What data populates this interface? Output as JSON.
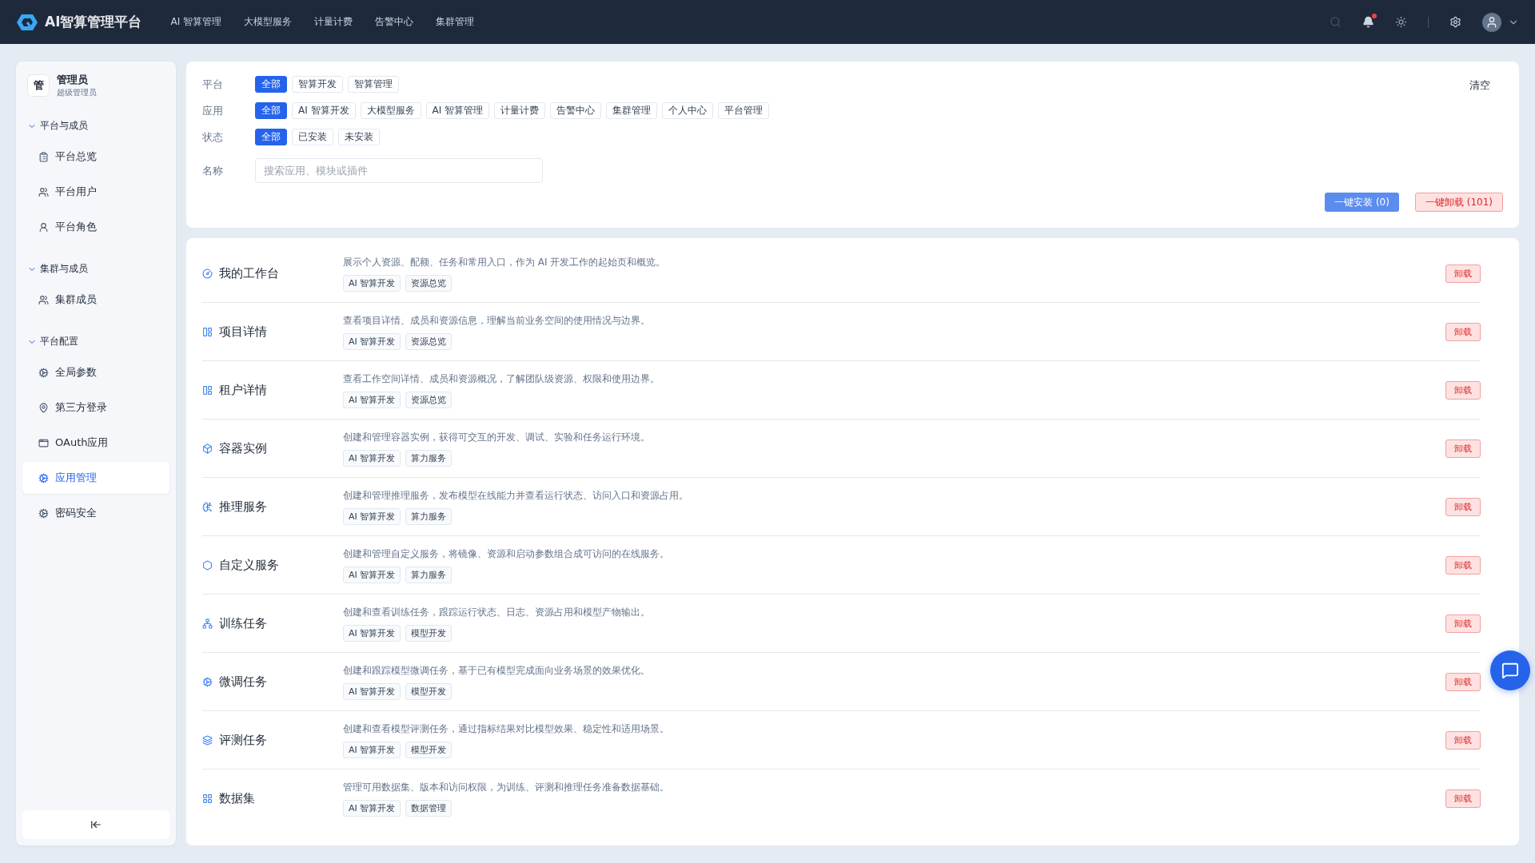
{
  "header": {
    "logo_text": "AI智算管理平台",
    "nav": [
      {
        "label": "AI 智算管理"
      },
      {
        "label": "大模型服务"
      },
      {
        "label": "计量计费"
      },
      {
        "label": "告警中心"
      },
      {
        "label": "集群管理"
      }
    ],
    "notification_dot": true
  },
  "sidebar": {
    "user": {
      "avatar": "管",
      "name": "管理员",
      "role": "超级管理员"
    },
    "groups": [
      {
        "title": "平台与成员",
        "expanded": true,
        "items": [
          {
            "label": "平台总览",
            "selected": false
          },
          {
            "label": "平台用户",
            "selected": false
          },
          {
            "label": "平台角色",
            "selected": false
          }
        ]
      },
      {
        "title": "集群与成员",
        "expanded": true,
        "items": [
          {
            "label": "集群成员",
            "selected": false
          }
        ]
      },
      {
        "title": "平台配置",
        "expanded": true,
        "items": [
          {
            "label": "全局参数",
            "selected": false
          },
          {
            "label": "第三方登录",
            "selected": false
          },
          {
            "label": "OAuth应用",
            "selected": false
          },
          {
            "label": "应用管理",
            "selected": true
          },
          {
            "label": "密码安全",
            "selected": false
          }
        ]
      }
    ]
  },
  "filters": {
    "clear": "清空",
    "rows": [
      {
        "label": "平台",
        "options": [
          {
            "label": "全部",
            "selected": true
          },
          {
            "label": "智算开发",
            "selected": false
          },
          {
            "label": "智算管理",
            "selected": false
          }
        ]
      },
      {
        "label": "应用",
        "options": [
          {
            "label": "全部",
            "selected": true
          },
          {
            "label": "AI 智算开发",
            "selected": false
          },
          {
            "label": "大模型服务",
            "selected": false
          },
          {
            "label": "AI 智算管理",
            "selected": false
          },
          {
            "label": "计量计费",
            "selected": false
          },
          {
            "label": "告警中心",
            "selected": false
          },
          {
            "label": "集群管理",
            "selected": false
          },
          {
            "label": "个人中心",
            "selected": false
          },
          {
            "label": "平台管理",
            "selected": false
          }
        ]
      },
      {
        "label": "状态",
        "options": [
          {
            "label": "全部",
            "selected": true
          },
          {
            "label": "已安装",
            "selected": false
          },
          {
            "label": "未安装",
            "selected": false
          }
        ]
      }
    ],
    "name_label": "名称",
    "search": {
      "placeholder": "搜索应用、模块或插件"
    },
    "install_all": "一键安装 (0)",
    "uninstall_all": "一键卸载 (101)"
  },
  "apps": [
    {
      "name": "我的工作台",
      "description": "展示个人资源、配额、任务和常用入口，作为 AI 开发工作的起始页和概览。",
      "tags": [
        "AI 智算开发",
        "资源总览"
      ],
      "action": "卸载"
    },
    {
      "name": "项目详情",
      "description": "查看项目详情、成员和资源信息，理解当前业务空间的使用情况与边界。",
      "tags": [
        "AI 智算开发",
        "资源总览"
      ],
      "action": "卸载"
    },
    {
      "name": "租户详情",
      "description": "查看工作空间详情、成员和资源概况，了解团队级资源、权限和使用边界。",
      "tags": [
        "AI 智算开发",
        "资源总览"
      ],
      "action": "卸载"
    },
    {
      "name": "容器实例",
      "description": "创建和管理容器实例，获得可交互的开发、调试、实验和任务运行环境。",
      "tags": [
        "AI 智算开发",
        "算力服务"
      ],
      "action": "卸载"
    },
    {
      "name": "推理服务",
      "description": "创建和管理推理服务，发布模型在线能力并查看运行状态、访问入口和资源占用。",
      "tags": [
        "AI 智算开发",
        "算力服务"
      ],
      "action": "卸载"
    },
    {
      "name": "自定义服务",
      "description": "创建和管理自定义服务，将镜像、资源和启动参数组合成可访问的在线服务。",
      "tags": [
        "AI 智算开发",
        "算力服务"
      ],
      "action": "卸载"
    },
    {
      "name": "训练任务",
      "description": "创建和查看训练任务，跟踪运行状态、日志、资源占用和模型产物输出。",
      "tags": [
        "AI 智算开发",
        "模型开发"
      ],
      "action": "卸载"
    },
    {
      "name": "微调任务",
      "description": "创建和跟踪模型微调任务，基于已有模型完成面向业务场景的效果优化。",
      "tags": [
        "AI 智算开发",
        "模型开发"
      ],
      "action": "卸载"
    },
    {
      "name": "评测任务",
      "description": "创建和查看模型评测任务，通过指标结果对比模型效果、稳定性和适用场景。",
      "tags": [
        "AI 智算开发",
        "模型开发"
      ],
      "action": "卸载"
    },
    {
      "name": "数据集",
      "description": "管理可用数据集、版本和访问权限，为训练、评测和推理任务准备数据基础。",
      "tags": [
        "AI 智算开发",
        "数据管理"
      ],
      "action": "卸载"
    }
  ]
}
